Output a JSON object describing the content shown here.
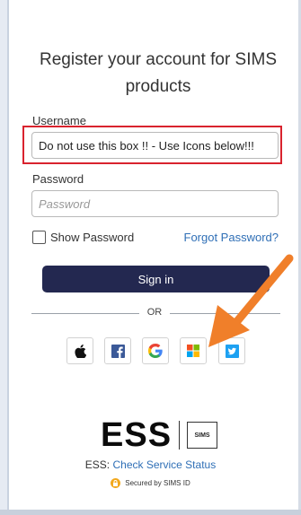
{
  "form": {
    "title": "Register your account for SIMS products",
    "username_label": "Username",
    "username_value": "Do not use this box !! - Use Icons below!!!",
    "password_label": "Password",
    "password_placeholder": "Password",
    "show_password_label": "Show Password",
    "forgot_password_label": "Forgot Password?",
    "signin_label": "Sign in",
    "or_text": "OR"
  },
  "social_icons": [
    {
      "name": "apple-icon"
    },
    {
      "name": "facebook-icon"
    },
    {
      "name": "google-icon"
    },
    {
      "name": "microsoft-icon"
    },
    {
      "name": "twitter-icon"
    }
  ],
  "footer": {
    "ess_logo": "ESS",
    "sims_logo": "SIMS",
    "status_prefix": "ESS: ",
    "status_link": "Check Service Status",
    "secured_text": "Secured by SIMS ID"
  },
  "colors": {
    "signin_bg": "#232850",
    "highlight_border": "#d9232e",
    "annotation_arrow": "#f07f2a",
    "link": "#2f6fb6"
  }
}
